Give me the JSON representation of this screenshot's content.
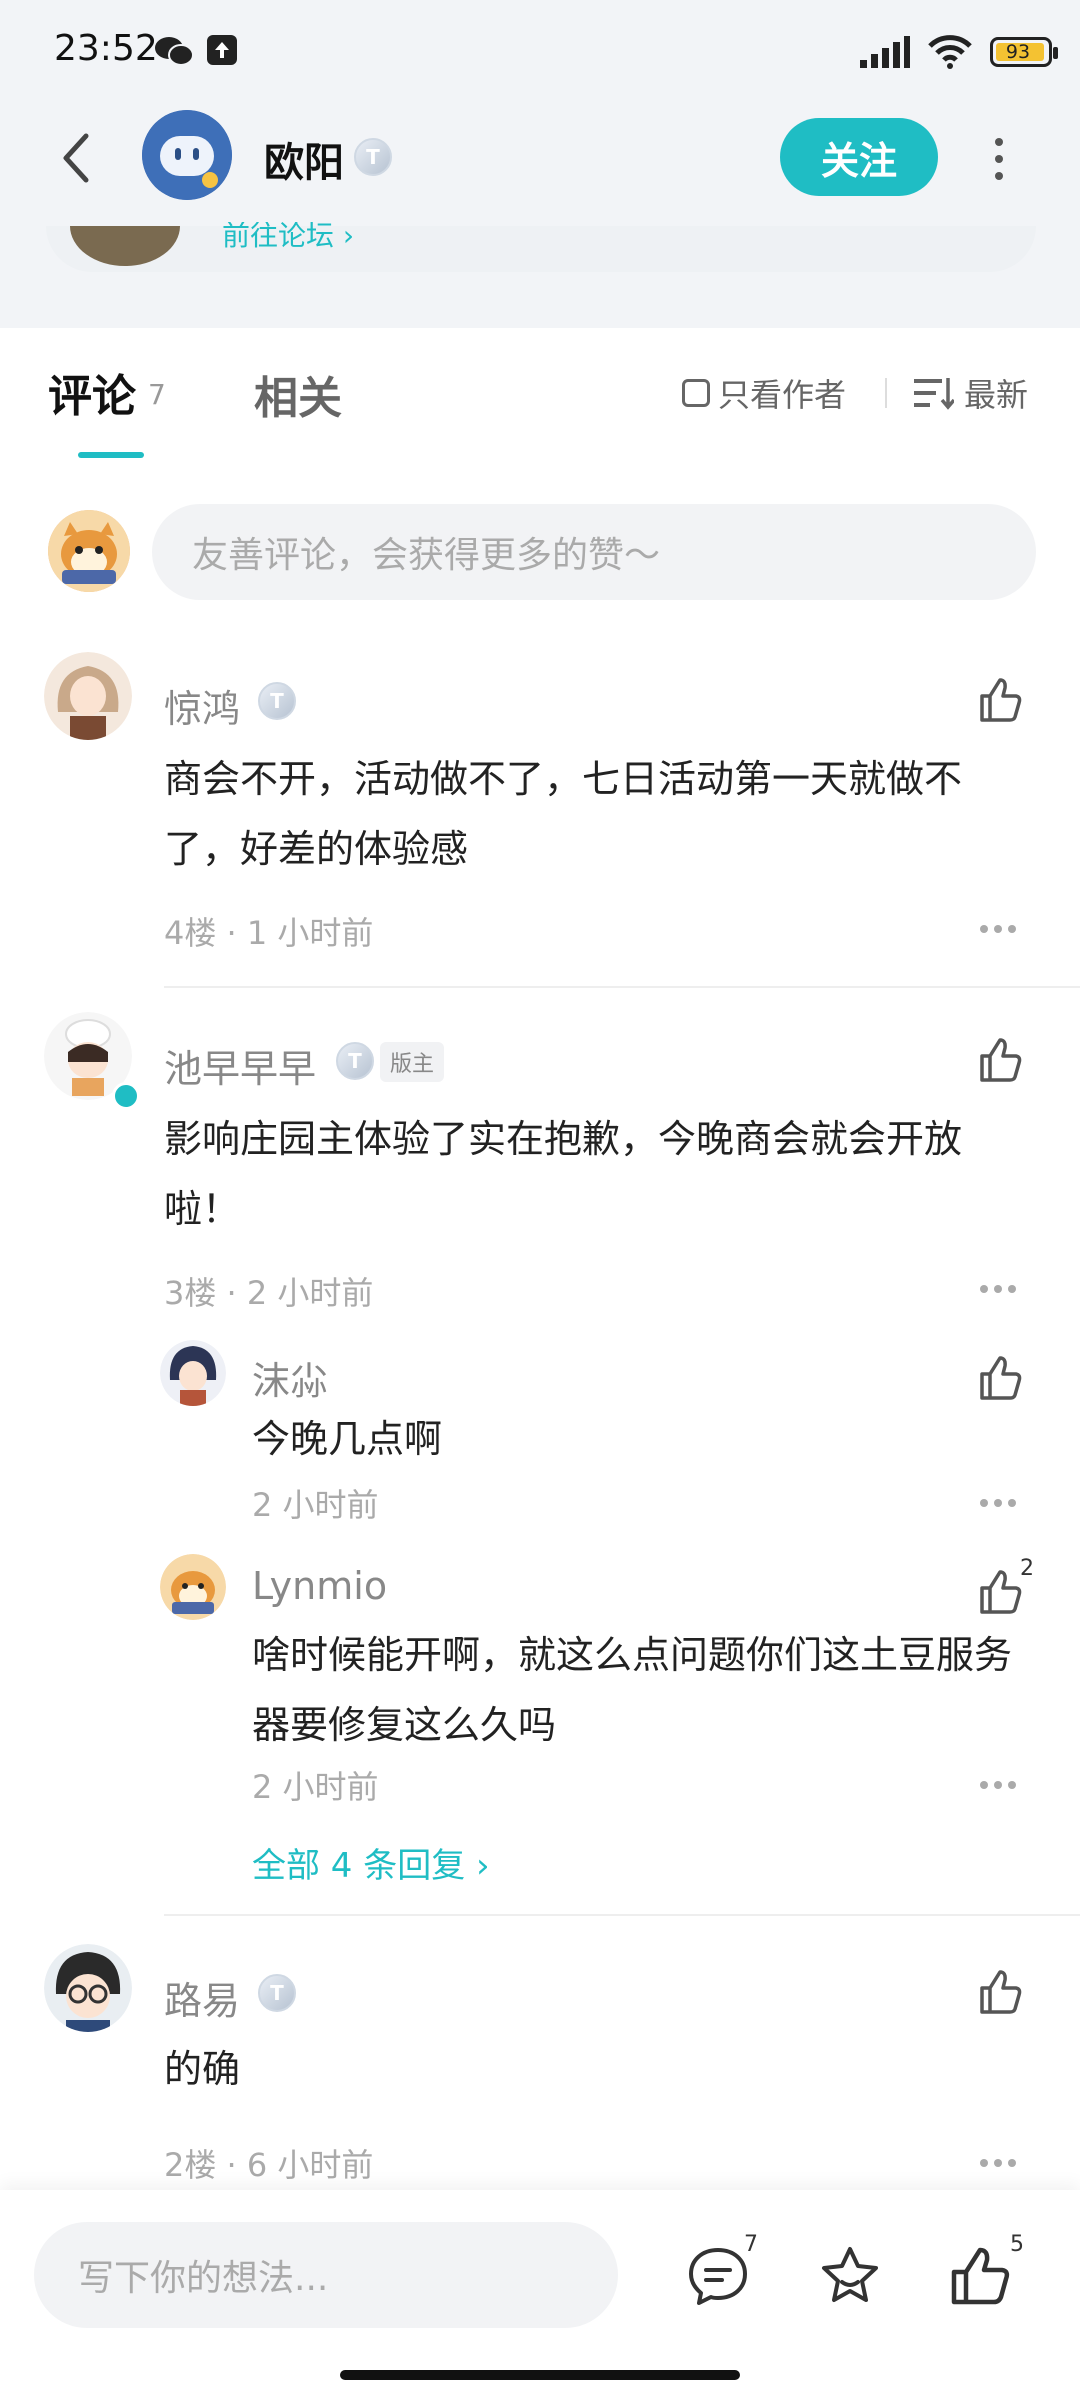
{
  "status_bar": {
    "time": "23:52",
    "battery": "93"
  },
  "header": {
    "author_name": "欧阳",
    "author_level": "T",
    "follow_label": "关注",
    "peek_text": "前往论坛 ›"
  },
  "tabs": {
    "comments_label": "评论",
    "comments_count": "7",
    "related_label": "相关",
    "only_author_label": "只看作者",
    "sort_label": "最新"
  },
  "comment_input": {
    "placeholder": "友善评论，会获得更多的赞～"
  },
  "comments": [
    {
      "name": "惊鸿",
      "level": "T",
      "text": "商会不开，活动做不了，七日活动第一天就做不了，好差的体验感",
      "meta": "4楼 · 1 小时前"
    },
    {
      "name": "池早早早",
      "level": "T",
      "badge": "版主",
      "text": "影响庄园主体验了实在抱歉，今晚商会就会开放啦！",
      "meta": "3楼 · 2 小时前",
      "replies": [
        {
          "name": "沫尛",
          "text": "今晚几点啊",
          "meta": "2 小时前"
        },
        {
          "name": "Lynmio",
          "text": "啥时候能开啊，就这么点问题你们这土豆服务器要修复这么久吗",
          "meta": "2 小时前",
          "likes": "2"
        }
      ],
      "all_replies_label": "全部 4 条回复 ›"
    },
    {
      "name": "路易",
      "level": "T",
      "text": "的确",
      "meta": "2楼 · 6 小时前"
    }
  ],
  "bottom_bar": {
    "placeholder": "写下你的想法...",
    "comment_count": "7",
    "like_count": "5"
  },
  "colors": {
    "accent": "#1fbdc4",
    "header_bg": "#f2f4f7"
  }
}
